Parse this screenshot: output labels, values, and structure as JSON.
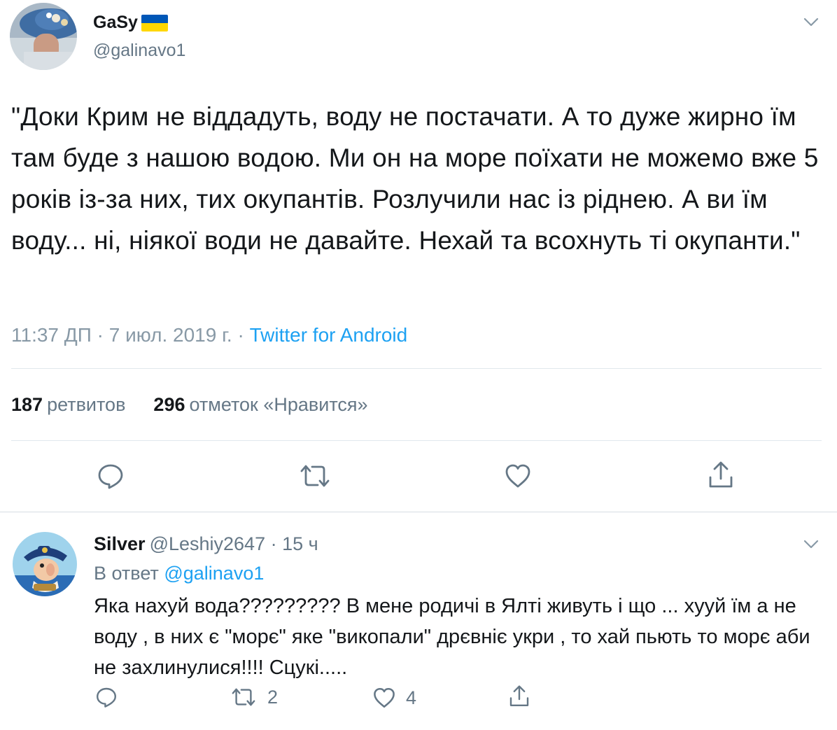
{
  "main_tweet": {
    "display_name": "GaSy",
    "handle": "@galinavo1",
    "text": "\"Доки Крим не віддадуть, воду не постачати. А то дуже жирно їм там буде з нашою водою. Ми он на море поїхати не можемо вже 5 років із-за них, тих окупантів. Розлучили нас із ріднею. А ви їм воду... ні, ніякої води не давайте. Нехай та всохнуть ті окупанти.\"",
    "time": "11:37 ДП",
    "date": "7 июл. 2019 г.",
    "separator": " · ",
    "source": "Twitter for Android",
    "retweets_count": "187",
    "retweets_label": "ретвитов",
    "likes_count": "296",
    "likes_label": "отметок «Нравится»",
    "flag_colors": [
      "#0057b7",
      "#ffd700"
    ]
  },
  "reply": {
    "display_name": "Silver",
    "handle": "@Leshiy2647",
    "time_ago": "15 ч",
    "reply_to_label": "В ответ",
    "reply_to_handle": "@galinavo1",
    "text": "Яка нахуй вода????????? В мене родичі в Ялті живуть і що ... хууй їм а не воду  , в них є \"морє\" яке \"викопали\" дрєвніє укри , то хай пьють то морє аби не захлинулися!!!! Сцукі.....",
    "retweet_count": "2",
    "like_count": "4"
  },
  "icons": {
    "reply": "comment-icon",
    "retweet": "retweet-icon",
    "like": "heart-icon",
    "share": "share-icon",
    "menu": "chevron-down-icon"
  },
  "colors": {
    "text": "#14171a",
    "secondary": "#657786",
    "meta": "#8899a6",
    "link": "#1da1f2",
    "divider": "#e1e8ed"
  }
}
